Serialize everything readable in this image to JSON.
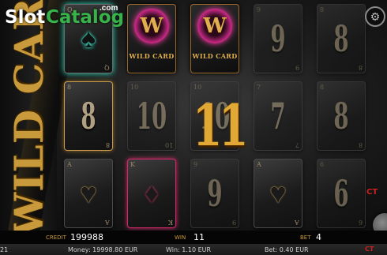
{
  "logo": {
    "part1": "Slot",
    "part2": "Catalog",
    "suffix": ".com"
  },
  "banner": {
    "text": "WILD CARD"
  },
  "reels": [
    [
      {
        "type": "teal-spade",
        "corner": "Q",
        "dim": false
      },
      {
        "type": "rank",
        "rank": "8",
        "corner": "8",
        "dim": false,
        "highlight": true
      },
      {
        "type": "heart",
        "corner": "A",
        "dim": false
      }
    ],
    [
      {
        "type": "wild",
        "symbol": "W",
        "label": "WILD CARD",
        "dim": false
      },
      {
        "type": "rank",
        "rank": "10",
        "corner": "10",
        "dim": true
      },
      {
        "type": "pink-diamond",
        "corner": "K",
        "dim": false
      }
    ],
    [
      {
        "type": "wild",
        "symbol": "W",
        "label": "WILD CARD",
        "dim": false
      },
      {
        "type": "rank",
        "rank": "10",
        "corner": "10",
        "dim": true
      },
      {
        "type": "rank",
        "rank": "9",
        "corner": "9",
        "dim": true
      }
    ],
    [
      {
        "type": "rank",
        "rank": "9",
        "corner": "9",
        "dim": true
      },
      {
        "type": "rank",
        "rank": "7",
        "corner": "7",
        "dim": true
      },
      {
        "type": "heart",
        "corner": "A",
        "dim": false
      }
    ],
    [
      {
        "type": "rank",
        "rank": "8",
        "corner": "8",
        "dim": true
      },
      {
        "type": "rank",
        "rank": "8",
        "corner": "8",
        "dim": true
      },
      {
        "type": "rank",
        "rank": "6",
        "corner": "6",
        "dim": true
      }
    ]
  ],
  "win_display": {
    "value": "11"
  },
  "icons": {
    "settings": "gear-icon",
    "spin": "spin-button"
  },
  "brand": {
    "text": "CT"
  },
  "info_bar": {
    "credit_label": "CREDIT",
    "credit_value": "199988",
    "win_label": "WIN",
    "win_value": "11",
    "bet_label": "BET",
    "bet_value": "4"
  },
  "status_bar": {
    "time": "21",
    "money": "Money: 19998.80 EUR",
    "win": "Win: 1.10 EUR",
    "bet": "Bet: 0.40 EUR"
  }
}
